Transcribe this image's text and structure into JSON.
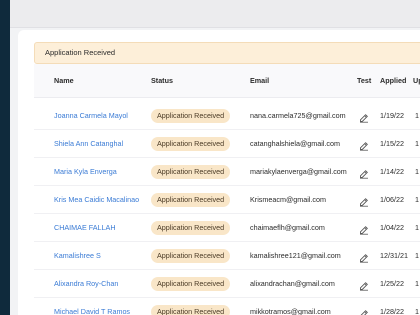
{
  "banner": {
    "text": "Application Received"
  },
  "table": {
    "headers": {
      "name": "Name",
      "status": "Status",
      "email": "Email",
      "test": "Test",
      "applied": "Applied",
      "updated": "Up"
    },
    "rows": [
      {
        "name": "Joanna Carmela Mayol",
        "status": "Application Received",
        "email": "nana.carmela725@gmail.com",
        "applied": "1/19/22",
        "updated": "1"
      },
      {
        "name": "Shiela Ann Catanghal",
        "status": "Application Received",
        "email": "catanghalshiela@gmail.com",
        "applied": "1/15/22",
        "updated": "1"
      },
      {
        "name": "Maria Kyla Enverga",
        "status": "Application Received",
        "email": "mariakylaenverga@gmail.com",
        "applied": "1/14/22",
        "updated": "1"
      },
      {
        "name": "Kris Mea Caidic Macalinao",
        "status": "Application Received",
        "email": "Krismeacm@gmail.com",
        "applied": "1/06/22",
        "updated": "1"
      },
      {
        "name": "CHAIMAE FALLAH",
        "status": "Application Received",
        "email": "chaimaeflh@gmail.com",
        "applied": "1/04/22",
        "updated": "1"
      },
      {
        "name": "Kamalishree S",
        "status": "Application Received",
        "email": "kamalishree121@gmail.com",
        "applied": "12/31/21",
        "updated": "1"
      },
      {
        "name": "Alixandra Roy-Chan",
        "status": "Application Received",
        "email": "alixandrachan@gmail.com",
        "applied": "1/25/22",
        "updated": "1"
      },
      {
        "name": "Michael David T Ramos",
        "status": "Application Received",
        "email": "mikkotramos@gmail.com",
        "applied": "1/28/22",
        "updated": "1"
      }
    ]
  },
  "icons": {
    "edit": "edit-icon"
  },
  "colors": {
    "sidebar": "#0f2a3c",
    "badge_bg": "#f9e6c8",
    "link": "#3a7bd5",
    "banner_bg": "#fdefd9"
  }
}
